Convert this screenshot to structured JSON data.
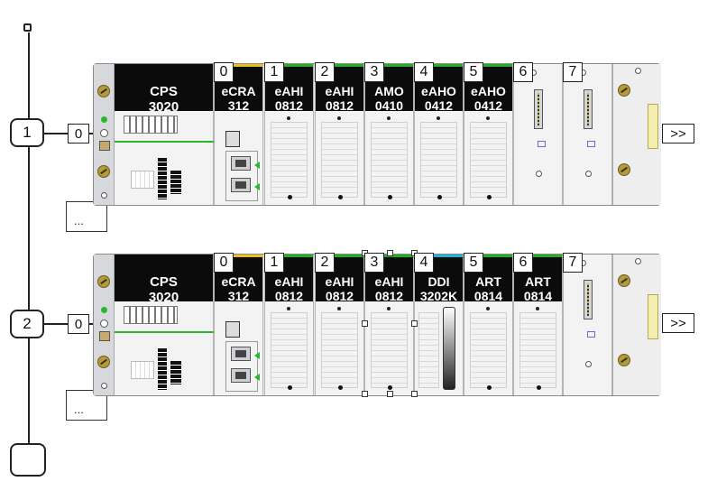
{
  "racks": [
    {
      "rack_number": "1",
      "address": "0",
      "expand_label": ">>",
      "ellipsis_label": "...",
      "power_supply": {
        "line1": "CPS",
        "line2": "3020"
      },
      "modules": [
        {
          "slot": "0",
          "line1": "eCRA",
          "line2": "312",
          "strip": "#e8c21c"
        },
        {
          "slot": "1",
          "line1": "eAHI",
          "line2": "0812",
          "strip": "#22b022"
        },
        {
          "slot": "2",
          "line1": "eAHI",
          "line2": "0812",
          "strip": "#22b022"
        },
        {
          "slot": "3",
          "line1": "AMO",
          "line2": "0410",
          "strip": "#22b022"
        },
        {
          "slot": "4",
          "line1": "eAHO",
          "line2": "0412",
          "strip": "#22b022"
        },
        {
          "slot": "5",
          "line1": "eAHO",
          "line2": "0412",
          "strip": "#22b022"
        },
        {
          "slot": "6",
          "line1": "",
          "line2": "",
          "strip": ""
        },
        {
          "slot": "7",
          "line1": "",
          "line2": "",
          "strip": ""
        }
      ]
    },
    {
      "rack_number": "2",
      "address": "0",
      "expand_label": ">>",
      "ellipsis_label": "...",
      "power_supply": {
        "line1": "CPS",
        "line2": "3020"
      },
      "modules": [
        {
          "slot": "0",
          "line1": "eCRA",
          "line2": "312",
          "strip": "#e8c21c"
        },
        {
          "slot": "1",
          "line1": "eAHI",
          "line2": "0812",
          "strip": "#22b022"
        },
        {
          "slot": "2",
          "line1": "eAHI",
          "line2": "0812",
          "strip": "#22b022"
        },
        {
          "slot": "3",
          "line1": "eAHI",
          "line2": "0812",
          "strip": "#22b022"
        },
        {
          "slot": "4",
          "line1": "DDI",
          "line2": "3202K",
          "strip": "#1fb6d6"
        },
        {
          "slot": "5",
          "line1": "ART",
          "line2": "0814",
          "strip": "#22b022"
        },
        {
          "slot": "6",
          "line1": "ART",
          "line2": "0814",
          "strip": "#22b022"
        },
        {
          "slot": "7",
          "line1": "",
          "line2": "",
          "strip": ""
        }
      ]
    }
  ],
  "colors": {
    "bus": "#222222",
    "status_green": "#2db52d",
    "module_header": "#0b0b0b"
  }
}
